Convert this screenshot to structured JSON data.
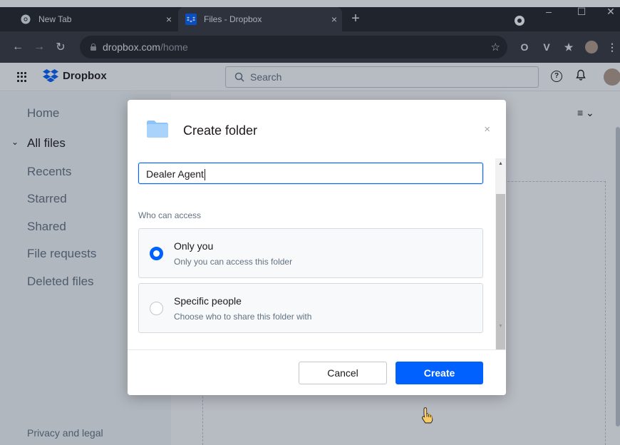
{
  "browser": {
    "tabs": [
      {
        "title": "New Tab",
        "active": false
      },
      {
        "title": "Files - Dropbox",
        "active": true
      }
    ],
    "new_tab": "+",
    "close_glyph": "×",
    "window_controls": {
      "minimize": "–",
      "maximize": "☐",
      "close": "✕"
    },
    "url_host": "dropbox.com",
    "url_path": "/home",
    "extensions": [
      "O",
      "V",
      "★"
    ]
  },
  "app": {
    "brand": "Dropbox",
    "search_placeholder": "Search",
    "help_glyph": "?",
    "bell_glyph": "🔔"
  },
  "sidebar": {
    "items": [
      {
        "label": "Home",
        "active": false
      },
      {
        "label": "All files",
        "active": true,
        "expanded": true
      },
      {
        "label": "Recents",
        "active": false
      },
      {
        "label": "Starred",
        "active": false
      },
      {
        "label": "Shared",
        "active": false
      },
      {
        "label": "File requests",
        "active": false
      },
      {
        "label": "Deleted files",
        "active": false
      }
    ],
    "expand_chevron": "⌄",
    "footer": "Privacy and legal"
  },
  "view_menu": "≡ ⌄",
  "dialog": {
    "title": "Create folder",
    "close": "×",
    "folder_name_value": "Dealer Agent",
    "access_label": "Who can access",
    "options": [
      {
        "title": "Only you",
        "description": "Only you can access this folder",
        "selected": true
      },
      {
        "title": "Specific people",
        "description": "Choose who to share this folder with",
        "selected": false
      }
    ],
    "cancel_label": "Cancel",
    "create_label": "Create"
  },
  "colors": {
    "accent": "#0061fe",
    "folder": "#8cc4f8",
    "overlay": "rgba(30,45,65,0.32)"
  }
}
